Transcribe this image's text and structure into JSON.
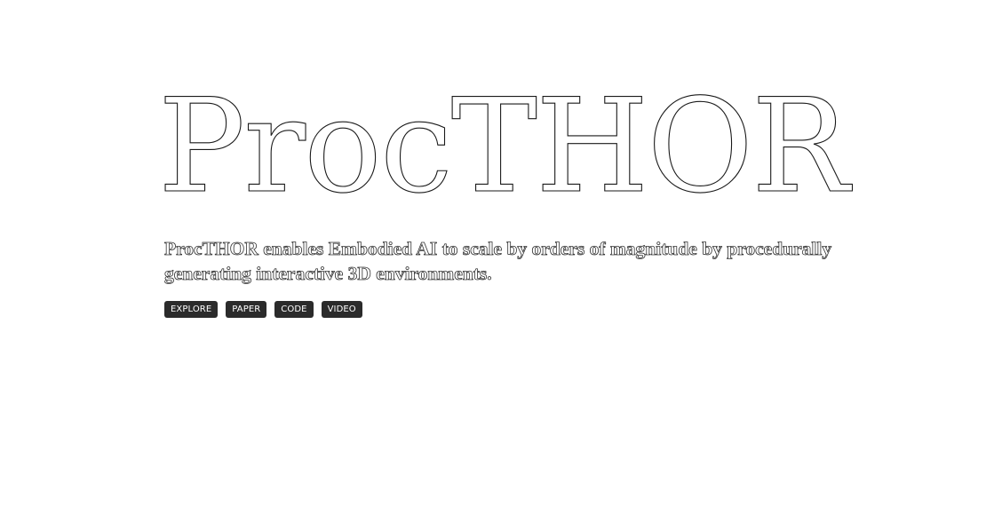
{
  "hero": {
    "title": "ProcTHOR",
    "subtitle": "ProcTHOR enables Embodied AI to scale by orders of magnitude by procedurally generating interactive 3D environments.",
    "buttons": [
      {
        "label": "EXPLORE"
      },
      {
        "label": "PAPER"
      },
      {
        "label": "CODE"
      },
      {
        "label": "VIDEO"
      }
    ]
  },
  "colors": {
    "background": "#ffffff",
    "button_bg": "#2b2b2b",
    "button_text": "#ffffff",
    "outline": "#1a1a1a"
  }
}
